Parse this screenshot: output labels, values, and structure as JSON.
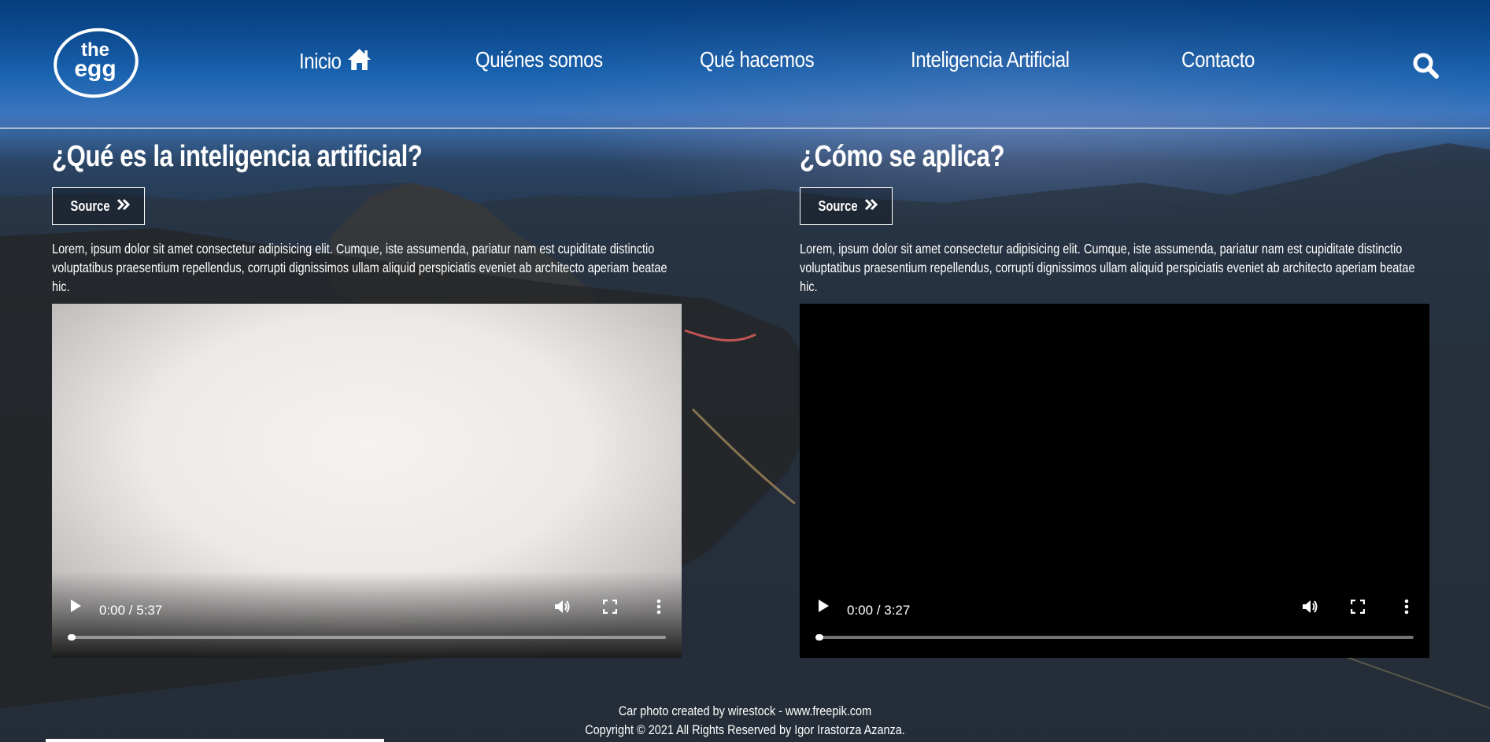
{
  "brand": {
    "logo_line1": "the",
    "logo_line2": "egg"
  },
  "nav": {
    "items": [
      {
        "label": "Inicio"
      },
      {
        "label": "Quiénes somos"
      },
      {
        "label": "Qué hacemos"
      },
      {
        "label": "Inteligencia Artificial"
      },
      {
        "label": "Contacto"
      }
    ]
  },
  "sections": [
    {
      "title": "¿Qué es la inteligencia artificial?",
      "source_label": "Source",
      "text": "Lorem, ipsum dolor sit amet consectetur adipisicing elit. Cumque, iste assumenda, pariatur nam est cupiditate distinctio voluptatibus praesentium repellendus, corrupti dignissimos ullam aliquid perspiciatis eveniet ab architecto aperiam beatae hic.",
      "video": {
        "time": "0:00 / 5:37",
        "progress": 0
      }
    },
    {
      "title": "¿Cómo se aplica?",
      "source_label": "Source",
      "text": "Lorem, ipsum dolor sit amet consectetur adipisicing elit. Cumque, iste assumenda, pariatur nam est cupiditate distinctio voluptatibus praesentium repellendus, corrupti dignissimos ullam aliquid perspiciatis eveniet ab architecto aperiam beatae hic.",
      "video": {
        "time": "0:00 / 3:27",
        "progress": 0
      }
    }
  ],
  "footer": {
    "credit": "Car photo created by wirestock - www.freepik.com",
    "copyright": "Copyright © 2021 All Rights Reserved by Igor Irastorza Azanza."
  },
  "colors": {
    "header_blue": "#0a4a8e",
    "sky_purple": "#8c96c8",
    "video_dark": "#000000"
  }
}
